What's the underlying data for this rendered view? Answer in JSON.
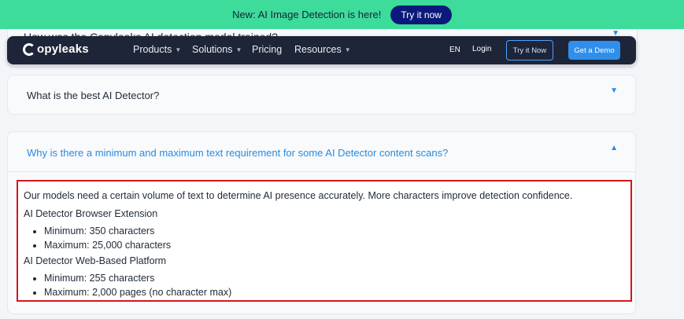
{
  "promo": {
    "text": "New: AI Image Detection is here!",
    "button_label": "Try it now"
  },
  "hidden_question": "How was the Copyleaks AI detection model trained?",
  "nav": {
    "logo_text": "opyleaks",
    "items": [
      {
        "label": "Products",
        "has_caret": true
      },
      {
        "label": "Solutions",
        "has_caret": true
      },
      {
        "label": "Pricing",
        "has_caret": false
      },
      {
        "label": "Resources",
        "has_caret": true
      }
    ],
    "lang": "EN",
    "login": "Login",
    "try_now": "Try it Now",
    "demo": "Get a Demo"
  },
  "faq": [
    {
      "question": "What is the best AI Detector?",
      "expanded": false
    },
    {
      "question": "Why is there a minimum and maximum text requirement for some AI Detector content scans?",
      "expanded": true,
      "answer": {
        "intro": "Our models need a certain volume of text to determine AI presence accurately. More characters improve detection confidence.",
        "sections": [
          {
            "title": "AI Detector Browser Extension",
            "bullets": [
              "Minimum: 350 characters",
              "Maximum: 25,000 characters"
            ]
          },
          {
            "title": "AI Detector Web-Based Platform",
            "bullets": [
              "Minimum: 255 characters",
              "Maximum: 2,000 pages (no character max)"
            ]
          }
        ]
      }
    }
  ],
  "colors": {
    "promo_bg": "#3ddc9a",
    "promo_button": "#0b1a7a",
    "nav_bg": "#1e2538",
    "accent": "#2b8ae0",
    "highlight_border": "#d7141a"
  },
  "icons": {
    "chevron_down": "chevron-down-icon",
    "chevron_up": "chevron-up-icon",
    "caret": "caret-down-icon"
  }
}
